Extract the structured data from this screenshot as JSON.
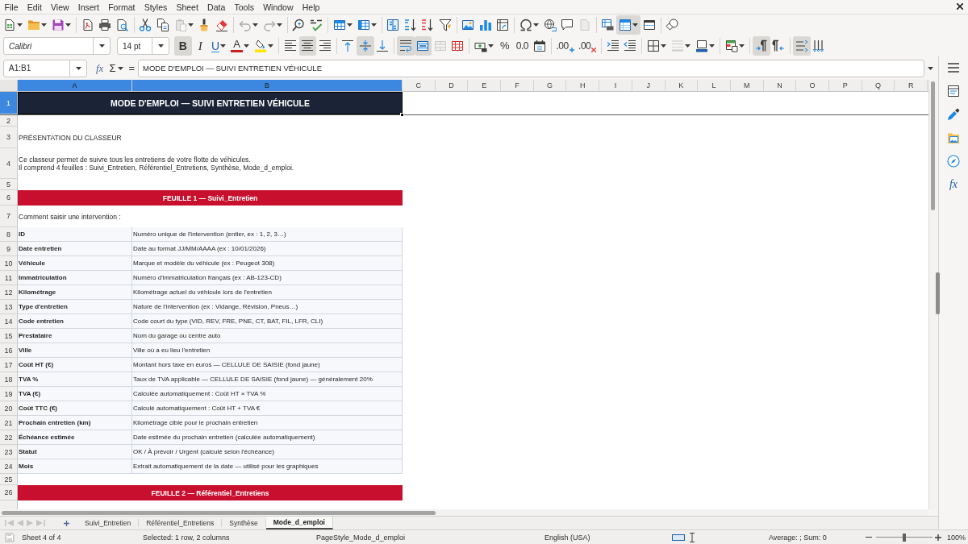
{
  "menu_bar": {
    "items": [
      "File",
      "Edit",
      "View",
      "Insert",
      "Format",
      "Styles",
      "Sheet",
      "Data",
      "Tools",
      "Window",
      "Help"
    ]
  },
  "standard_toolbar": [
    {
      "on": false,
      "disabled": false
    },
    {
      "on": false,
      "disabled": false
    },
    {
      "on": false,
      "disabled": false
    },
    {
      "on": false,
      "disabled": false
    },
    {
      "on": false,
      "disabled": false
    },
    {
      "on": false,
      "disabled": false
    },
    {
      "on": false,
      "disabled": false
    },
    {
      "on": false,
      "disabled": false
    },
    {
      "on": false,
      "disabled": true
    },
    {
      "on": false,
      "disabled": false
    },
    {
      "on": false,
      "disabled": false
    },
    {
      "on": false,
      "disabled": true
    },
    {
      "on": false,
      "disabled": true
    },
    {
      "on": false,
      "disabled": false
    },
    {
      "on": false,
      "disabled": false
    },
    {
      "on": false,
      "disabled": false
    },
    {
      "on": false,
      "disabled": false
    },
    {
      "on": false,
      "disabled": false
    },
    {
      "on": false,
      "disabled": false
    },
    {
      "on": false,
      "disabled": false
    },
    {
      "on": false,
      "disabled": false
    },
    {
      "on": false,
      "disabled": false
    },
    {
      "on": false,
      "disabled": false
    },
    {
      "on": false,
      "disabled": false
    },
    {
      "on": false,
      "disabled": false
    },
    {
      "on": false,
      "disabled": false
    },
    {
      "on": false,
      "disabled": false
    },
    {
      "on": false,
      "disabled": true
    },
    {
      "on": false,
      "disabled": false
    },
    {
      "on": true,
      "disabled": false
    },
    {
      "on": false,
      "disabled": false
    },
    {
      "on": false,
      "disabled": false
    }
  ],
  "formatting_toolbar": {
    "font_name": "Calibri",
    "font_size": "14 pt",
    "buttons": [
      {
        "label": "B",
        "on": true,
        "disabled": false
      },
      {
        "label": "I",
        "on": false,
        "disabled": false
      },
      {
        "label": "U",
        "on": false,
        "disabled": false
      },
      {
        "label": "A",
        "on": false,
        "disabled": false
      },
      {
        "on": false,
        "disabled": false
      },
      {
        "on": false,
        "disabled": false
      },
      {
        "on": true,
        "disabled": false
      },
      {
        "on": false,
        "disabled": false
      },
      {
        "on": false,
        "disabled": false
      },
      {
        "on": true,
        "disabled": false
      },
      {
        "on": false,
        "disabled": false
      },
      {
        "on": true,
        "disabled": false
      },
      {
        "on": true,
        "disabled": false
      },
      {
        "on": false,
        "disabled": true
      },
      {
        "on": false,
        "disabled": false
      },
      {
        "on": false,
        "disabled": false
      },
      {
        "label": "%",
        "on": false,
        "disabled": false
      },
      {
        "label": "0.0",
        "on": false,
        "disabled": false
      },
      {
        "on": false,
        "disabled": false
      },
      {
        "label": ".00",
        "on": false,
        "disabled": false
      },
      {
        "label": ".00",
        "on": false,
        "disabled": false
      },
      {
        "on": false,
        "disabled": false
      },
      {
        "on": false,
        "disabled": false
      },
      {
        "on": false,
        "disabled": false
      },
      {
        "on": false,
        "disabled": true
      },
      {
        "on": false,
        "disabled": false
      },
      {
        "on": false,
        "disabled": false
      },
      {
        "on": true,
        "disabled": false
      },
      {
        "on": false,
        "disabled": false
      },
      {
        "on": true,
        "disabled": false
      },
      {
        "on": false,
        "disabled": false
      }
    ]
  },
  "formula_bar": {
    "name_box": "A1:B1",
    "function_wizard": "fx",
    "sum": "Σ",
    "equals": "=",
    "content": "MODE D'EMPLOI — SUIVI ENTRETIEN VÉHICULE"
  },
  "sheet": {
    "columns": [
      {
        "label": "A",
        "selected": true
      },
      {
        "label": "B",
        "selected": true
      },
      {
        "label": "C",
        "selected": false
      },
      {
        "label": "D",
        "selected": false
      },
      {
        "label": "E",
        "selected": false
      },
      {
        "label": "F",
        "selected": false
      },
      {
        "label": "G",
        "selected": false
      },
      {
        "label": "H",
        "selected": false
      },
      {
        "label": "I",
        "selected": false
      },
      {
        "label": "J",
        "selected": false
      },
      {
        "label": "K",
        "selected": false
      },
      {
        "label": "L",
        "selected": false
      },
      {
        "label": "M",
        "selected": false
      },
      {
        "label": "N",
        "selected": false
      },
      {
        "label": "O",
        "selected": false
      },
      {
        "label": "P",
        "selected": false
      },
      {
        "label": "Q",
        "selected": false
      },
      {
        "label": "R",
        "selected": false
      }
    ],
    "rows": [
      {
        "number": "1",
        "selected": true,
        "kind": "title",
        "text": "MODE D'EMPLOI — SUIVI ENTRETIEN VÉHICULE"
      },
      {
        "number": "2",
        "selected": false,
        "kind": "blank"
      },
      {
        "number": "3",
        "selected": false,
        "kind": "text",
        "text": "PRÉSENTATION DU CLASSEUR"
      },
      {
        "number": "4",
        "selected": false,
        "kind": "text",
        "text": "Ce classeur permet de suivre tous les entretiens de votre flotte de véhicules.\nIl comprend 4 feuilles : Suivi_Entretien, Référentiel_Entretiens, Synthèse, Mode_d_emploi."
      },
      {
        "number": "5",
        "selected": false,
        "kind": "blank"
      },
      {
        "number": "6",
        "selected": false,
        "kind": "section",
        "text": "FEUILLE 1 — Suivi_Entretien"
      },
      {
        "number": "7",
        "selected": false,
        "kind": "text",
        "text": "Comment saisir une intervention :"
      },
      {
        "number": "8",
        "selected": false,
        "kind": "field",
        "label": "ID",
        "description": "Numéro unique de l'intervention (entier, ex : 1, 2, 3…)"
      },
      {
        "number": "9",
        "selected": false,
        "kind": "field",
        "label": "Date entretien",
        "description": "Date au format JJ/MM/AAAA (ex : 10/01/2026)"
      },
      {
        "number": "10",
        "selected": false,
        "kind": "field",
        "label": "Véhicule",
        "description": "Marque et modèle du véhicule (ex : Peugeot 308)"
      },
      {
        "number": "11",
        "selected": false,
        "kind": "field",
        "label": "Immatriculation",
        "description": "Numéro d'immatriculation français (ex : AB-123-CD)"
      },
      {
        "number": "12",
        "selected": false,
        "kind": "field",
        "label": "Kilométrage",
        "description": "Kilométrage actuel du véhicule lors de l'entretien"
      },
      {
        "number": "13",
        "selected": false,
        "kind": "field",
        "label": "Type d'entretien",
        "description": "Nature de l'intervention (ex : Vidange, Révision, Pneus…)"
      },
      {
        "number": "14",
        "selected": false,
        "kind": "field",
        "label": "Code entretien",
        "description": "Code court du type (VID, REV, FRE, PNE, CT, BAT, FIL, LFR, CLI)"
      },
      {
        "number": "15",
        "selected": false,
        "kind": "field",
        "label": "Prestataire",
        "description": "Nom du garage ou centre auto"
      },
      {
        "number": "16",
        "selected": false,
        "kind": "field",
        "label": "Ville",
        "description": "Ville où a eu lieu l'entretien"
      },
      {
        "number": "17",
        "selected": false,
        "kind": "field",
        "label": "Coût HT (€)",
        "description": "Montant hors taxe en euros — CELLULE DE SAISIE (fond jaune)"
      },
      {
        "number": "18",
        "selected": false,
        "kind": "field",
        "label": "TVA %",
        "description": "Taux de TVA applicable — CELLULE DE SAISIE (fond jaune) — généralement 20%"
      },
      {
        "number": "19",
        "selected": false,
        "kind": "field",
        "label": "TVA (€)",
        "description": "Calculée automatiquement : Coût HT × TVA %"
      },
      {
        "number": "20",
        "selected": false,
        "kind": "field",
        "label": "Coût TTC (€)",
        "description": "Calculé automatiquement : Coût HT + TVA €"
      },
      {
        "number": "21",
        "selected": false,
        "kind": "field",
        "label": "Prochain entretien (km)",
        "description": "Kilométrage cible pour le prochain entretien"
      },
      {
        "number": "22",
        "selected": false,
        "kind": "field",
        "label": "Échéance estimée",
        "description": "Date estimée du prochain entretien (calculée automatiquement)"
      },
      {
        "number": "23",
        "selected": false,
        "kind": "field",
        "label": "Statut",
        "description": "OK / À prévoir / Urgent (calculé selon l'échéance)"
      },
      {
        "number": "24",
        "selected": false,
        "kind": "field",
        "label": "Mois",
        "description": "Extrait automatiquement de la date — utilisé pour les graphiques"
      },
      {
        "number": "25",
        "selected": false,
        "kind": "blank"
      },
      {
        "number": "26",
        "selected": false,
        "kind": "section",
        "text": "FEUILLE 2 — Référentiel_Entretiens"
      }
    ]
  },
  "sheet_navigation": [
    {
      "disabled": true
    },
    {
      "disabled": true
    },
    {
      "disabled": true
    },
    {
      "disabled": true
    }
  ],
  "sheet_tabs": [
    {
      "label": "Suivi_Entretien",
      "selected": false
    },
    {
      "label": "Référentiel_Entretiens",
      "selected": false
    },
    {
      "label": "Synthèse",
      "selected": false
    },
    {
      "label": "Mode_d_emploi",
      "selected": true
    }
  ],
  "sidebar": {
    "functions_label": "fx"
  },
  "status_bar": {
    "sheet": "Sheet 4 of 4",
    "selection": "Selected: 1 row, 2 columns",
    "page_style": "PageStyle_Mode_d_emploi",
    "language": "English (USA)",
    "statistics": "Average: ; Sum: 0",
    "zoom": {
      "level": 0.5,
      "reading": "100%"
    }
  }
}
